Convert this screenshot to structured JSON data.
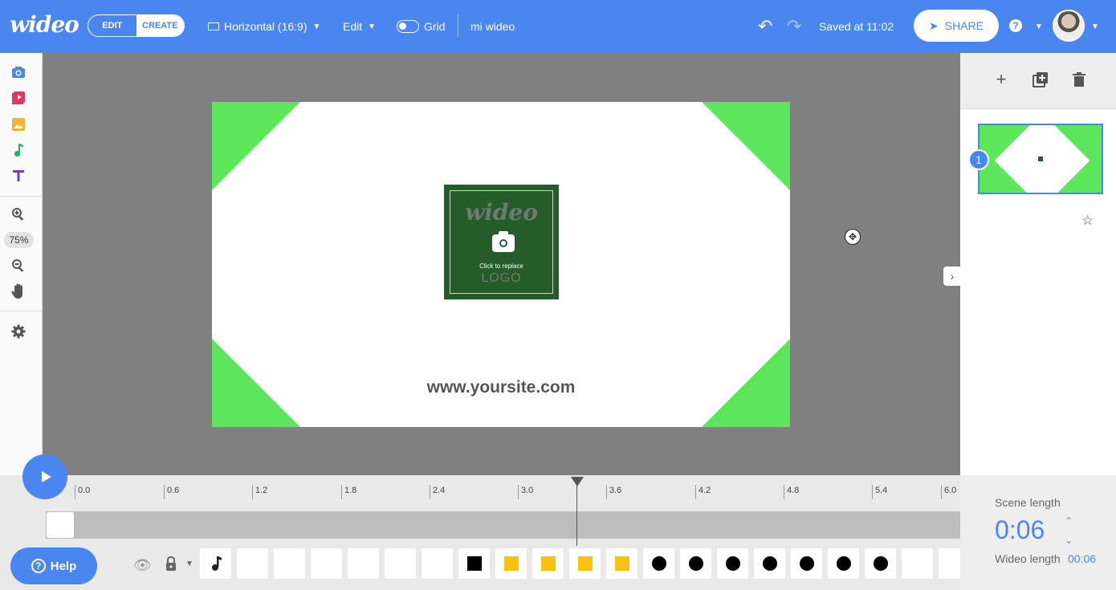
{
  "header": {
    "brand": "wideo",
    "mode_edit": "EDIT",
    "mode_create": "CREATE",
    "format": "Horizontal (16:9)",
    "edit_menu": "Edit",
    "grid": "Grid",
    "project_name": "mi wideo",
    "saved": "Saved at 11:02",
    "share": "SHARE",
    "help_icon_label": "?"
  },
  "left_tools": {
    "zoom": "75%"
  },
  "canvas": {
    "logo_word": "wideo",
    "click_to_replace": "Click to replace",
    "logo_text": "LOGO",
    "website": "www.yoursite.com"
  },
  "colors": {
    "accent": "#4a86f0",
    "canvas_green": "#5ce65c",
    "logo_green": "#265c2a",
    "yellow": "#fcc10f"
  },
  "scenes": {
    "items": [
      {
        "number": "1"
      }
    ]
  },
  "timeline": {
    "ticks": [
      "0.0",
      "0.6",
      "1.2",
      "1.8",
      "2.4",
      "3.0",
      "3.6",
      "4.2",
      "4.8",
      "5.4",
      "6.0"
    ],
    "playhead_seconds": 3.4
  },
  "footer": {
    "help": "Help"
  },
  "scene_panel": {
    "scene_length_label": "Scene length",
    "scene_length": "0:06",
    "wideo_length_label": "Wideo length",
    "wideo_length": "00:06"
  }
}
